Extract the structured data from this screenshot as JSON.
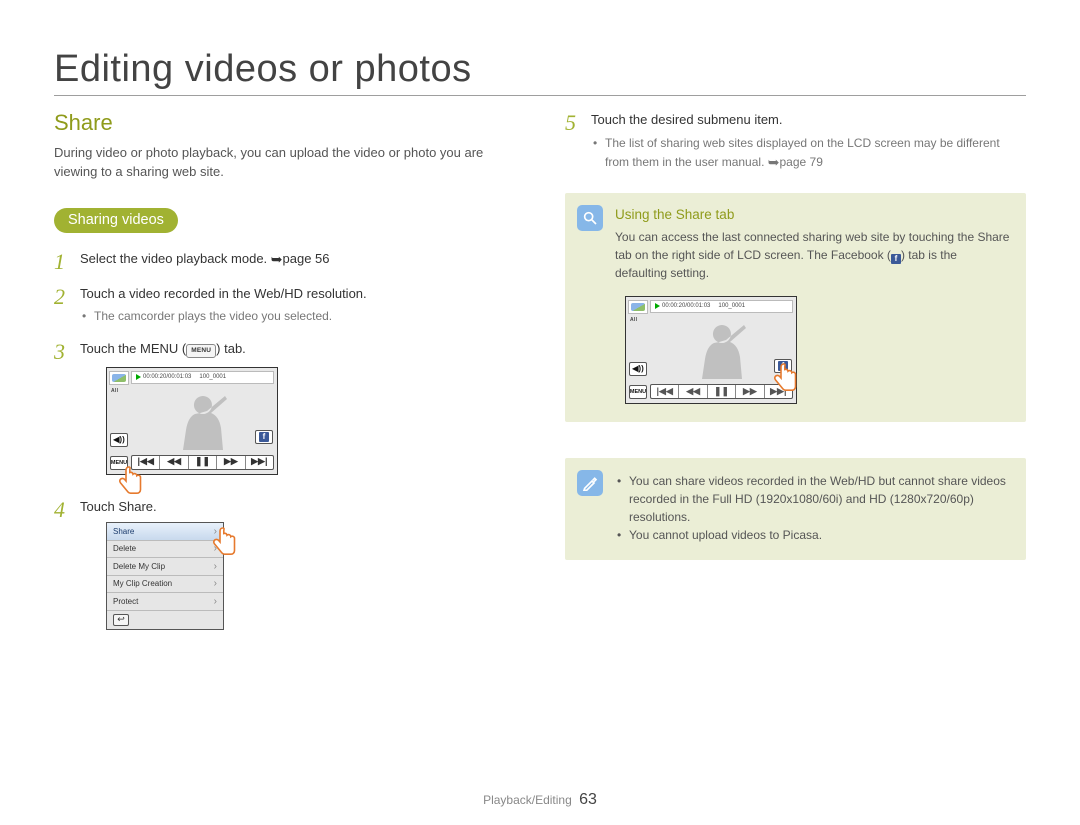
{
  "page": {
    "title": "Editing videos or photos",
    "footer_section": "Playback/Editing",
    "page_number": "63"
  },
  "left": {
    "section_title": "Share",
    "intro": "During video or photo playback, you can upload the video or photo you are viewing to a sharing web site.",
    "pill": "Sharing videos",
    "steps": [
      {
        "text_pre": "Select the video playback mode. ",
        "ref": "page 56"
      },
      {
        "text": "Touch a video recorded in the Web/HD resolution.",
        "sub": [
          "The camcorder plays the video you selected."
        ]
      },
      {
        "text_pre": "Touch the MENU (",
        "text_mid": "MENU",
        "text_post": ") tab."
      },
      {
        "text_pre": "Touch ",
        "bold": "Share",
        "text_post": "."
      }
    ],
    "lcd": {
      "timecode": "00:00:20/00:01:03",
      "file": "100_0001",
      "all": "All",
      "menu": "MENU"
    },
    "menu_items": [
      "Share",
      "Delete",
      "Delete My Clip",
      "My Clip Creation",
      "Protect"
    ]
  },
  "right": {
    "steps": [
      {
        "text": "Touch the desired submenu item.",
        "sub_pre": "The list of sharing web sites displayed on the LCD screen may be different from them in the user manual. ",
        "sub_ref": "page 79"
      }
    ],
    "callout1": {
      "title": "Using the Share tab",
      "text_pre": "You can access the last connected sharing web site by touching the Share tab on the right side of LCD screen. The Facebook (",
      "text_post": ") tab is the defaulting setting."
    },
    "callout2": {
      "items": [
        "You can share videos recorded in the Web/HD but cannot share videos recorded in the Full HD (1920x1080/60i) and HD (1280x720/60p) resolutions.",
        "You cannot upload videos to Picasa."
      ]
    }
  },
  "icons": {
    "magnifier": "magnifier-icon",
    "note": "note-icon",
    "facebook": "f"
  }
}
